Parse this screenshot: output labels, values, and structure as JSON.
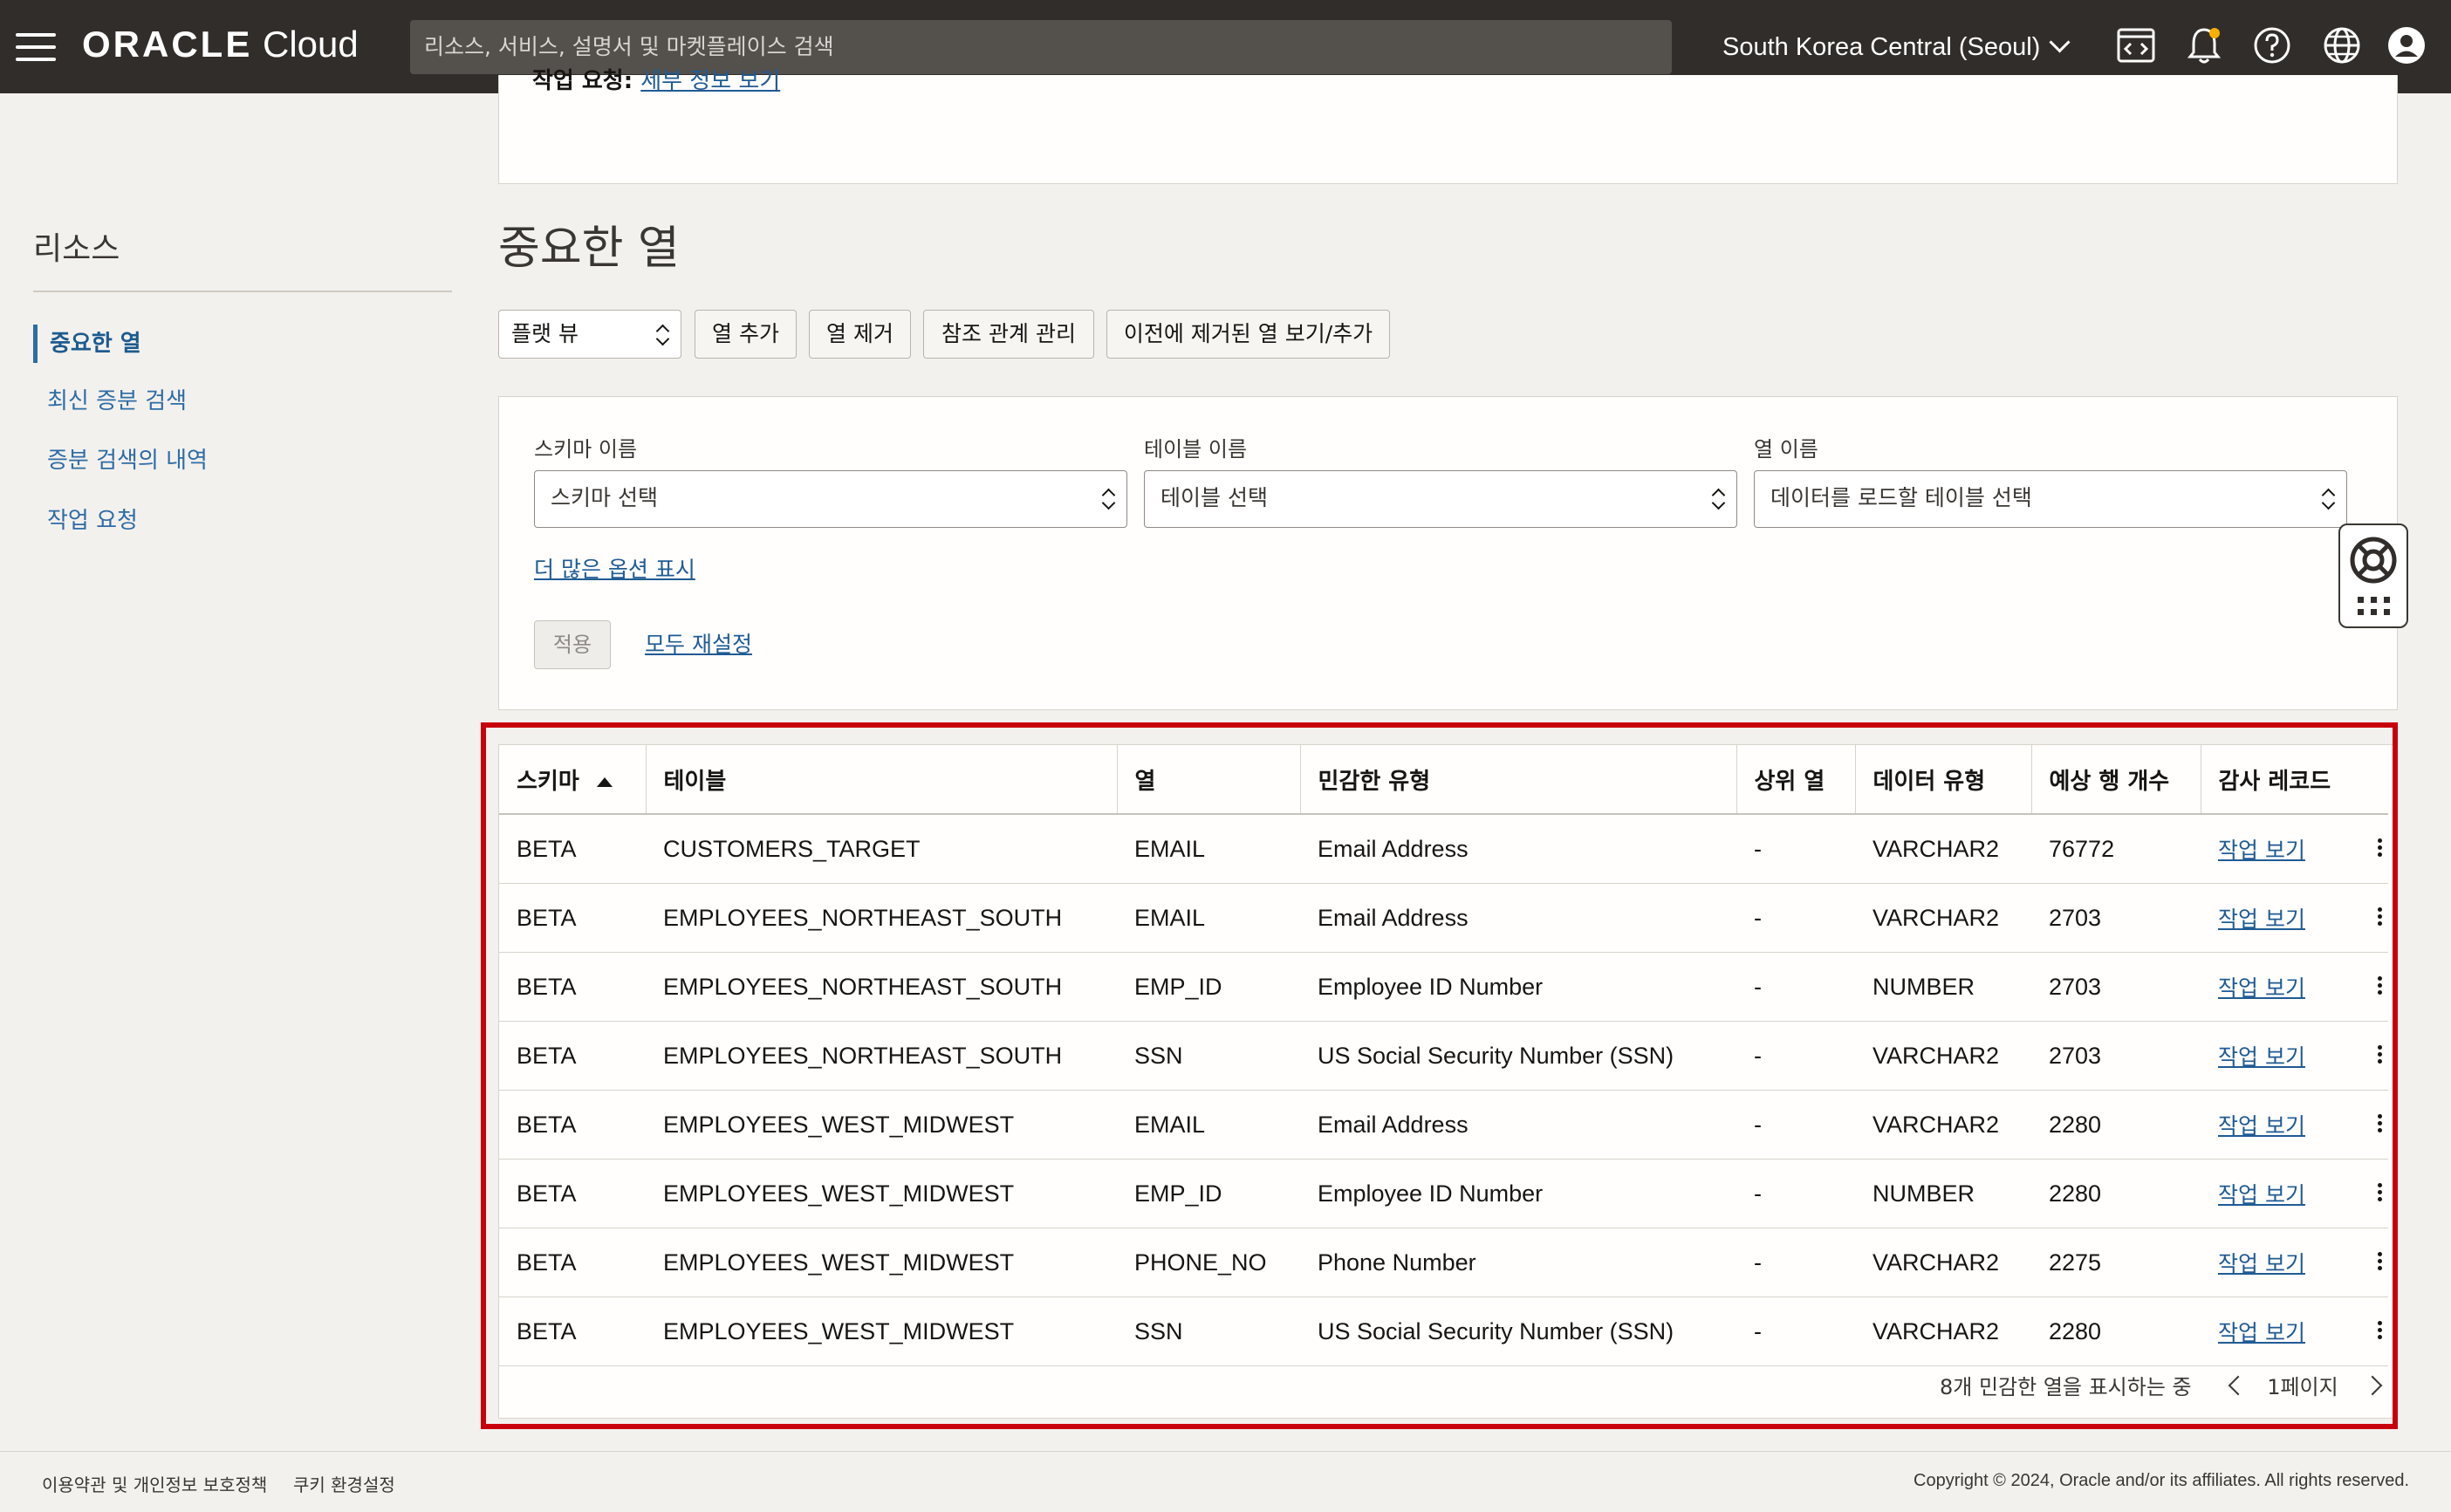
{
  "header": {
    "brand_bold": "ORACLE",
    "brand_light": " Cloud",
    "search_placeholder": "리소스, 서비스, 설명서 및 마켓플레이스 검색",
    "region": "South Korea Central (Seoul)"
  },
  "sidebar": {
    "title": "리소스",
    "items": [
      {
        "label": "중요한 열"
      },
      {
        "label": "최신 증분 검색"
      },
      {
        "label": "증분 검색의 내역"
      },
      {
        "label": "작업 요청"
      }
    ]
  },
  "topcard": {
    "label": "작업 요청:",
    "link": "세부 정보 보기"
  },
  "page": {
    "title": "중요한 열",
    "view_select": "플랫 뷰",
    "buttons": [
      "열 추가",
      "열 제거",
      "참조 관계 관리",
      "이전에 제거된 열 보기/추가"
    ]
  },
  "filters": {
    "schema_label": "스키마 이름",
    "schema_placeholder": "스키마 선택",
    "table_label": "테이블 이름",
    "table_placeholder": "테이블 선택",
    "column_label": "열 이름",
    "column_placeholder": "데이터를 로드할 테이블 선택",
    "more_options": "더 많은 옵션 표시",
    "apply": "적용",
    "reset": "모두 재설정"
  },
  "table": {
    "headers": [
      "스키마",
      "테이블",
      "열",
      "민감한 유형",
      "상위 열",
      "데이터 유형",
      "예상 행 개수",
      "감사 레코드"
    ],
    "rows": [
      {
        "schema": "BETA",
        "table": "CUSTOMERS_TARGET",
        "column": "EMAIL",
        "sensitive_type": "Email Address",
        "parent": "-",
        "data_type": "VARCHAR2",
        "rows": "76772",
        "audit": "작업 보기"
      },
      {
        "schema": "BETA",
        "table": "EMPLOYEES_NORTHEAST_SOUTH",
        "column": "EMAIL",
        "sensitive_type": "Email Address",
        "parent": "-",
        "data_type": "VARCHAR2",
        "rows": "2703",
        "audit": "작업 보기"
      },
      {
        "schema": "BETA",
        "table": "EMPLOYEES_NORTHEAST_SOUTH",
        "column": "EMP_ID",
        "sensitive_type": "Employee ID Number",
        "parent": "-",
        "data_type": "NUMBER",
        "rows": "2703",
        "audit": "작업 보기"
      },
      {
        "schema": "BETA",
        "table": "EMPLOYEES_NORTHEAST_SOUTH",
        "column": "SSN",
        "sensitive_type": "US Social Security Number (SSN)",
        "parent": "-",
        "data_type": "VARCHAR2",
        "rows": "2703",
        "audit": "작업 보기"
      },
      {
        "schema": "BETA",
        "table": "EMPLOYEES_WEST_MIDWEST",
        "column": "EMAIL",
        "sensitive_type": "Email Address",
        "parent": "-",
        "data_type": "VARCHAR2",
        "rows": "2280",
        "audit": "작업 보기"
      },
      {
        "schema": "BETA",
        "table": "EMPLOYEES_WEST_MIDWEST",
        "column": "EMP_ID",
        "sensitive_type": "Employee ID Number",
        "parent": "-",
        "data_type": "NUMBER",
        "rows": "2280",
        "audit": "작업 보기"
      },
      {
        "schema": "BETA",
        "table": "EMPLOYEES_WEST_MIDWEST",
        "column": "PHONE_NO",
        "sensitive_type": "Phone Number",
        "parent": "-",
        "data_type": "VARCHAR2",
        "rows": "2275",
        "audit": "작업 보기"
      },
      {
        "schema": "BETA",
        "table": "EMPLOYEES_WEST_MIDWEST",
        "column": "SSN",
        "sensitive_type": "US Social Security Number (SSN)",
        "parent": "-",
        "data_type": "VARCHAR2",
        "rows": "2280",
        "audit": "작업 보기"
      }
    ],
    "footer_count": "8개 민감한 열을 표시하는 중",
    "page_label": "1페이지"
  },
  "footer": {
    "terms": "이용약관 및 개인정보 보호정책",
    "cookies": "쿠키 환경설정",
    "copyright": "Copyright © 2024, Oracle and/or its affiliates. All rights reserved."
  },
  "colors": {
    "topbar": "#312d2a",
    "link": "#1f5b94",
    "highlight_outline": "#c8000c"
  },
  "icons": [
    "hamburger-menu-icon",
    "code-editor-icon",
    "bell-icon",
    "help-icon",
    "globe-icon",
    "user-avatar-icon",
    "lifebuoy-icon",
    "grid-icon",
    "sort-ascending-icon",
    "kebab-menu-icon"
  ]
}
